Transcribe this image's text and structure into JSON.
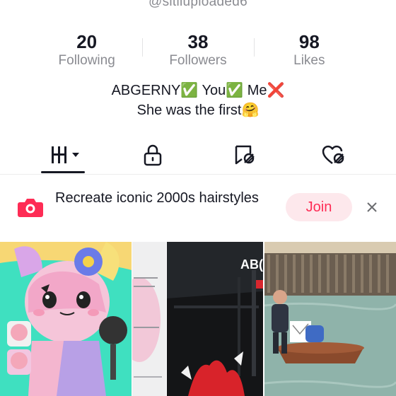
{
  "profile": {
    "username": "@sitiiuploaded6",
    "bio_line1": "ABGERNY✅ You✅ Me❌",
    "bio_line2": "She was the first🤗"
  },
  "stats": [
    {
      "value": "20",
      "label": "Following"
    },
    {
      "value": "38",
      "label": "Followers"
    },
    {
      "value": "98",
      "label": "Likes"
    }
  ],
  "tabs": [
    {
      "name": "videos",
      "icon": "grid-icon"
    },
    {
      "name": "private",
      "icon": "lock-icon"
    },
    {
      "name": "reposts",
      "icon": "repost-icon"
    },
    {
      "name": "liked",
      "icon": "liked-heart-icon"
    }
  ],
  "challenge": {
    "title": "Recreate iconic 2000s hairstyles",
    "join_label": "Join",
    "close_label": "×",
    "accent": "#fe2c55"
  },
  "videos": [
    {
      "description": "cartoon-drawing-thumbnail"
    },
    {
      "description": "text-post-thumbnail"
    },
    {
      "description": "dark-scene-thumbnail",
      "overlay": "AB("
    },
    {
      "description": "river-boat-thumbnail"
    }
  ]
}
